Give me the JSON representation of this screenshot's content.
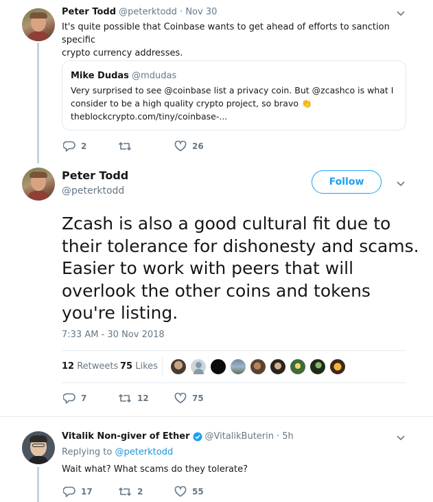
{
  "tweet1": {
    "name": "Peter Todd",
    "handle": "@peterktodd",
    "time": "· Nov 30",
    "text_line1": "It's quite possible that Coinbase wants to get ahead of efforts to sanction specific",
    "text_line2": "crypto currency addresses.",
    "quote": {
      "name": "Mike Dudas",
      "handle": "@mdudas",
      "line1": "Very surprised to see @coinbase list a privacy coin. But @zcashco is what I",
      "line2": "consider to be a high quality crypto project, so bravo",
      "emoji": "👏",
      "line3": "theblockcrypto.com/tiny/coinbase-..."
    },
    "replies": "2",
    "retweets": "",
    "likes": "26"
  },
  "main": {
    "name": "Peter Todd",
    "handle": "@peterktodd",
    "follow_label": "Follow",
    "text_lines": [
      "Zcash is also a good cultural fit due to",
      "their tolerance for dishonesty and scams.",
      "Easier to work with peers that will",
      "overlook the other coins and tokens",
      "you're listing."
    ],
    "timestamp": "7:33 AM - 30 Nov 2018",
    "retweets_count": "12",
    "retweets_label": "Retweets",
    "likes_count": "75",
    "likes_label": "Likes",
    "replies": "7",
    "retweets": "12",
    "likes": "75"
  },
  "reply": {
    "name": "Vitalik Non-giver of Ether",
    "handle": "@VitalikButerin",
    "time": "· 5h",
    "replying_prefix": "Replying to",
    "replying_to": "@peterktodd",
    "text": "Wait what? What scams do they tolerate?",
    "replies": "17",
    "retweets": "2",
    "likes": "55"
  },
  "icons": [
    "chevron-down-icon",
    "reply-icon",
    "retweet-icon",
    "heart-icon",
    "verified-icon"
  ],
  "colors": {
    "accent": "#1da1f2",
    "muted": "#657786",
    "thread": "#bed7e4",
    "border": "#e1e8ed"
  }
}
